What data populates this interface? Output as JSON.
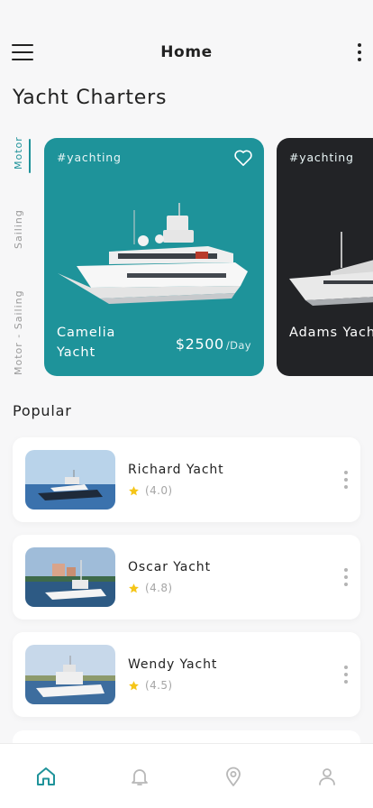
{
  "header": {
    "title": "Home"
  },
  "page_title": "Yacht Charters",
  "categories": [
    {
      "label": "Motor",
      "active": true
    },
    {
      "label": "Sailing",
      "active": false
    },
    {
      "label": "Motor - Sailing",
      "active": false
    }
  ],
  "featured": [
    {
      "tag": "#yachting",
      "name": "Camelia Yacht",
      "price": "$2500",
      "unit": "/Day",
      "color": "#1e939a"
    },
    {
      "tag": "#yachting",
      "name": "Adams Yacht",
      "price": "",
      "unit": "",
      "color": "#222326"
    }
  ],
  "popular": {
    "title": "Popular",
    "items": [
      {
        "name": "Richard Yacht",
        "rating": "(4.0)"
      },
      {
        "name": "Oscar Yacht",
        "rating": "(4.8)"
      },
      {
        "name": "Wendy Yacht",
        "rating": "(4.5)"
      }
    ]
  },
  "nav": {
    "items": [
      "home-icon",
      "bell-icon",
      "location-pin-icon",
      "user-icon"
    ],
    "active": "home-icon"
  },
  "colors": {
    "accent": "#1f939a",
    "star": "#f5c518",
    "dark_card": "#222326"
  }
}
